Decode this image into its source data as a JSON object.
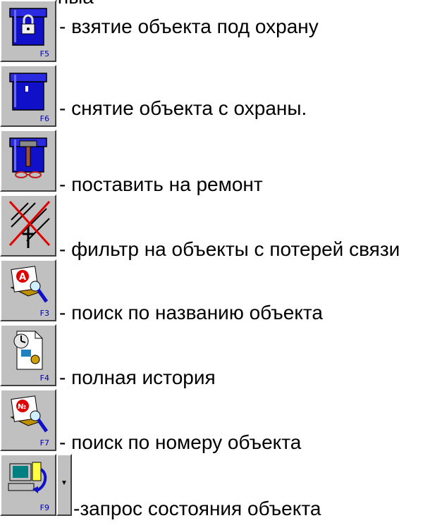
{
  "header_fragment": "Основныa",
  "items": [
    {
      "icon": "lock-box-icon",
      "fkey": "F5",
      "text": "- взятие объекта под охрану"
    },
    {
      "icon": "open-box-icon",
      "fkey": "F6",
      "text": "-  снятие объекта с охраны."
    },
    {
      "icon": "repair-box-icon",
      "fkey": "",
      "text": "- поставить на ремонт"
    },
    {
      "icon": "antenna-crossed-icon",
      "fkey": "",
      "text": "- фильтр на объекты с потерей связи"
    },
    {
      "icon": "search-name-icon",
      "fkey": "F3",
      "text": "- поиск по названию объекта"
    },
    {
      "icon": "history-icon",
      "fkey": "F4",
      "text": "- полная история"
    },
    {
      "icon": "search-number-icon",
      "fkey": "F7",
      "text": "- поиск по номеру объекта"
    },
    {
      "icon": "computer-query-icon",
      "fkey": "F9",
      "text": "-запрос состояния объекта"
    }
  ],
  "colors": {
    "button_face": "#c0c0c0",
    "box_blue": "#1010c8",
    "cross_red": "#e00000"
  }
}
